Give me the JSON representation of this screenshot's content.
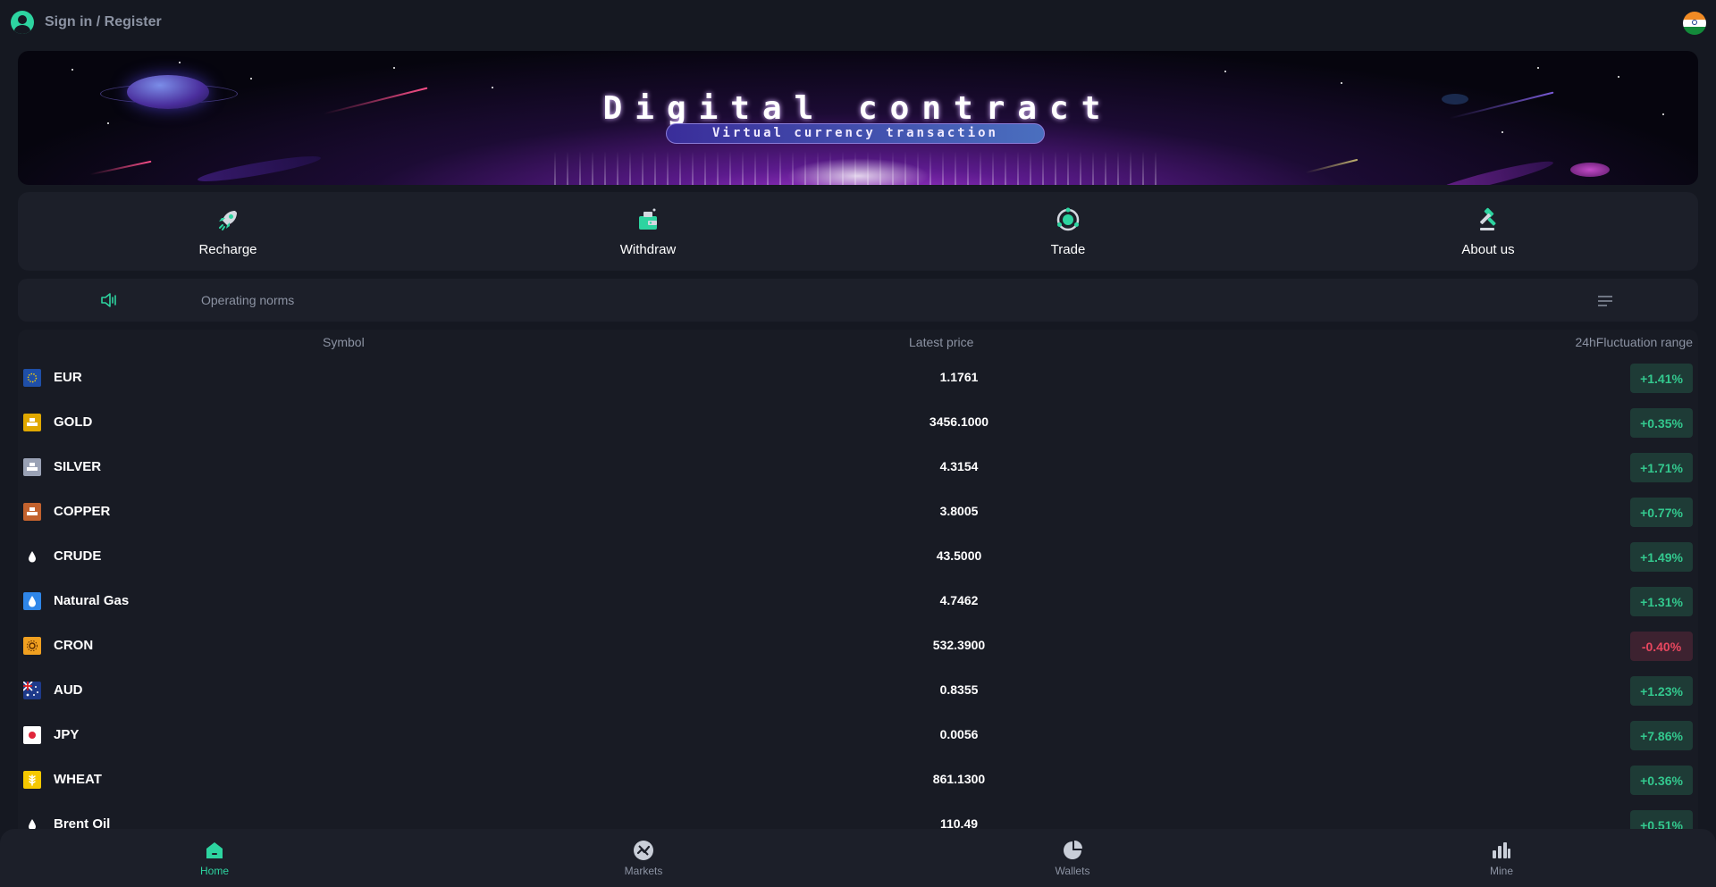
{
  "header": {
    "sign_in_label": "Sign in / Register",
    "language_flag_icon": "india-flag-icon"
  },
  "banner": {
    "title": "Digital contract",
    "subtitle": "Virtual currency transaction"
  },
  "actions": [
    {
      "label": "Recharge",
      "icon": "rocket-icon"
    },
    {
      "label": "Withdraw",
      "icon": "wallet-icon"
    },
    {
      "label": "Trade",
      "icon": "orbit-icon"
    },
    {
      "label": "About us",
      "icon": "gavel-icon"
    }
  ],
  "notice": {
    "text": "Operating norms",
    "icon": "speaker-icon",
    "menu_icon": "menu-icon"
  },
  "market": {
    "columns": {
      "symbol": "Symbol",
      "price": "Latest price",
      "change": "24hFluctuation range"
    },
    "rows": [
      {
        "symbol": "EUR",
        "price": "1.1761",
        "change": "+1.41%",
        "direction": "up",
        "icon": "eu-flag-icon"
      },
      {
        "symbol": "GOLD",
        "price": "3456.1000",
        "change": "+0.35%",
        "direction": "up",
        "icon": "gold-bars-icon"
      },
      {
        "symbol": "SILVER",
        "price": "4.3154",
        "change": "+1.71%",
        "direction": "up",
        "icon": "silver-bars-icon"
      },
      {
        "symbol": "COPPER",
        "price": "3.8005",
        "change": "+0.77%",
        "direction": "up",
        "icon": "copper-bars-icon"
      },
      {
        "symbol": "CRUDE",
        "price": "43.5000",
        "change": "+1.49%",
        "direction": "up",
        "icon": "oil-drop-icon"
      },
      {
        "symbol": "Natural Gas",
        "price": "4.7462",
        "change": "+1.31%",
        "direction": "up",
        "icon": "gas-drop-icon"
      },
      {
        "symbol": "CRON",
        "price": "532.3900",
        "change": "-0.40%",
        "direction": "down",
        "icon": "cron-icon"
      },
      {
        "symbol": "AUD",
        "price": "0.8355",
        "change": "+1.23%",
        "direction": "up",
        "icon": "australia-flag-icon"
      },
      {
        "symbol": "JPY",
        "price": "0.0056",
        "change": "+7.86%",
        "direction": "up",
        "icon": "japan-flag-icon"
      },
      {
        "symbol": "WHEAT",
        "price": "861.1300",
        "change": "+0.36%",
        "direction": "up",
        "icon": "wheat-icon"
      },
      {
        "symbol": "Brent Oil",
        "price": "110.49",
        "change": "+0.51%",
        "direction": "up",
        "icon": "oil-drop-icon"
      }
    ]
  },
  "bottom_nav": [
    {
      "label": "Home",
      "icon": "home-icon",
      "active": true
    },
    {
      "label": "Markets",
      "icon": "markets-icon",
      "active": false
    },
    {
      "label": "Wallets",
      "icon": "pie-chart-icon",
      "active": false
    },
    {
      "label": "Mine",
      "icon": "bar-chart-icon",
      "active": false
    }
  ],
  "colors": {
    "accent": "#2dd4a0",
    "up": "#33c88e",
    "down": "#e8475f",
    "background": "#151821",
    "card": "#1c1f29"
  }
}
